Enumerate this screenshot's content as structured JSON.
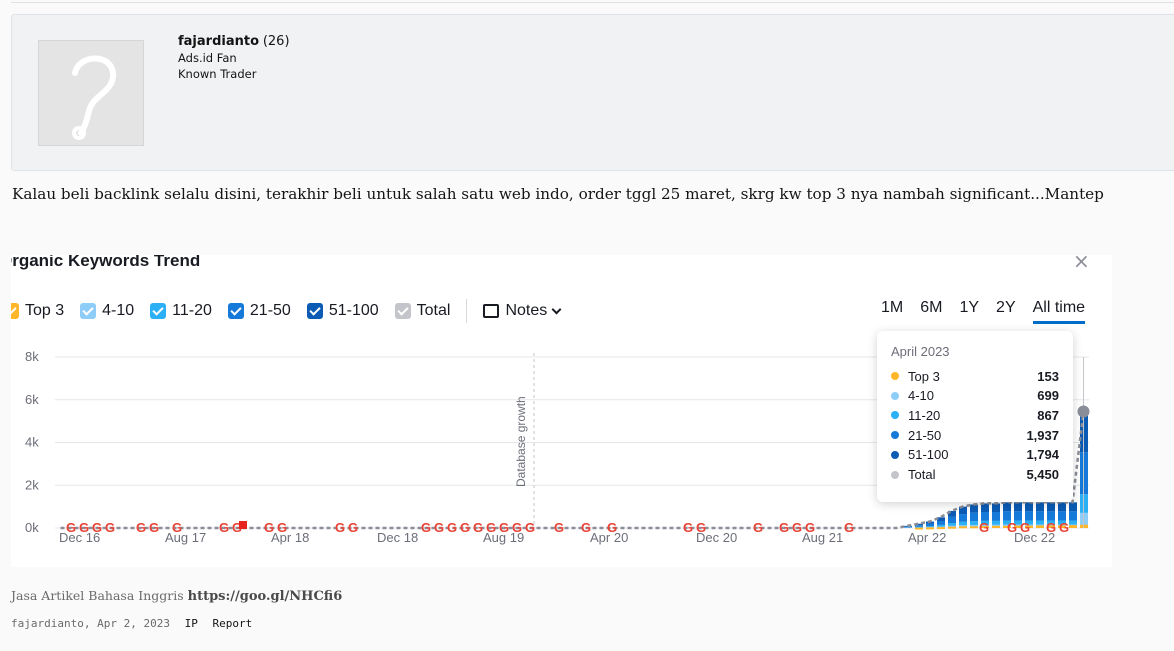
{
  "author": {
    "username": "fajardianto",
    "post_count": "(26)",
    "title1": "Ads.id Fan",
    "title2": "Known Trader"
  },
  "post": {
    "text": "Kalau beli backlink selalu disini, terakhir beli untuk salah satu web indo, order tggl 25 maret, skrg kw top 3 nya nambah significant...Mantep"
  },
  "chart_card": {
    "title": "Organic Keywords Trend",
    "close_icon": "×",
    "legend": [
      {
        "label": "Top 3",
        "color": "#ffb629"
      },
      {
        "label": "4-10",
        "color": "#8fcdf9"
      },
      {
        "label": "11-20",
        "color": "#2bb0f6"
      },
      {
        "label": "21-50",
        "color": "#1479d8"
      },
      {
        "label": "51-100",
        "color": "#0b5bb5"
      },
      {
        "label": "Total",
        "color": "#c3c5ca"
      }
    ],
    "notes_label": "Notes",
    "ranges": [
      "1M",
      "6M",
      "1Y",
      "2Y",
      "All time"
    ],
    "active_range": "All time",
    "annotation": "Database growth",
    "tooltip": {
      "title": "April 2023",
      "rows": [
        {
          "label": "Top 3",
          "value": "153",
          "color": "#ffb629"
        },
        {
          "label": "4-10",
          "value": "699",
          "color": "#8fcdf9"
        },
        {
          "label": "11-20",
          "value": "867",
          "color": "#2bb0f6"
        },
        {
          "label": "21-50",
          "value": "1,937",
          "color": "#1479d8"
        },
        {
          "label": "51-100",
          "value": "1,794",
          "color": "#0b5bb5"
        },
        {
          "label": "Total",
          "value": "5,450",
          "color": "#c3c5ca"
        }
      ]
    }
  },
  "chart_data": {
    "type": "bar",
    "ylim": [
      0,
      8000
    ],
    "yticks": [
      "0k",
      "2k",
      "4k",
      "6k",
      "8k"
    ],
    "xticks": [
      "Dec 16",
      "Aug 17",
      "Apr 18",
      "Dec 18",
      "Aug 19",
      "Apr 20",
      "Dec 20",
      "Aug 21",
      "Apr 22",
      "Dec 22"
    ],
    "grid": true,
    "series": [
      {
        "name": "Top 3",
        "values": [
          0,
          0,
          0,
          0,
          0,
          0,
          0,
          0,
          0,
          0,
          0,
          0,
          0,
          0,
          0,
          0,
          0,
          0,
          0,
          0,
          0,
          0,
          0,
          0,
          0,
          0,
          0,
          0,
          0,
          0,
          0,
          0,
          0,
          0,
          0,
          0,
          0,
          0,
          0,
          0,
          0,
          0,
          0,
          0,
          0,
          0,
          0,
          0,
          0,
          0,
          0,
          0,
          0,
          0,
          0,
          0,
          0,
          0,
          0,
          0,
          0,
          0,
          0,
          0,
          0,
          0,
          0,
          0,
          0,
          0,
          0,
          0,
          0,
          0,
          0,
          0,
          0,
          0,
          20,
          30,
          40,
          60,
          80,
          80,
          90,
          100,
          100,
          110,
          110,
          120,
          120,
          120,
          130,
          153
        ]
      },
      {
        "name": "Total",
        "values": [
          0,
          0,
          0,
          0,
          0,
          0,
          0,
          0,
          0,
          0,
          0,
          0,
          0,
          0,
          0,
          0,
          0,
          0,
          0,
          0,
          0,
          0,
          0,
          0,
          0,
          0,
          0,
          0,
          0,
          0,
          0,
          0,
          0,
          0,
          0,
          0,
          0,
          0,
          0,
          0,
          0,
          0,
          0,
          0,
          0,
          0,
          0,
          0,
          0,
          0,
          0,
          0,
          0,
          0,
          0,
          0,
          0,
          0,
          0,
          0,
          0,
          0,
          0,
          0,
          0,
          0,
          0,
          0,
          0,
          0,
          0,
          0,
          0,
          0,
          0,
          0,
          0,
          100,
          200,
          300,
          500,
          800,
          1000,
          1100,
          1150,
          1150,
          1200,
          1200,
          1200,
          1200,
          1200,
          1200,
          1200,
          5450
        ]
      }
    ]
  },
  "signature": {
    "text": "Jasa Artikel Bahasa Inggris",
    "link": "https://goo.gl/NHCfi6"
  },
  "meta": {
    "posted": "fajardianto, Apr 2, 2023",
    "ip": "IP",
    "report": "Report"
  }
}
